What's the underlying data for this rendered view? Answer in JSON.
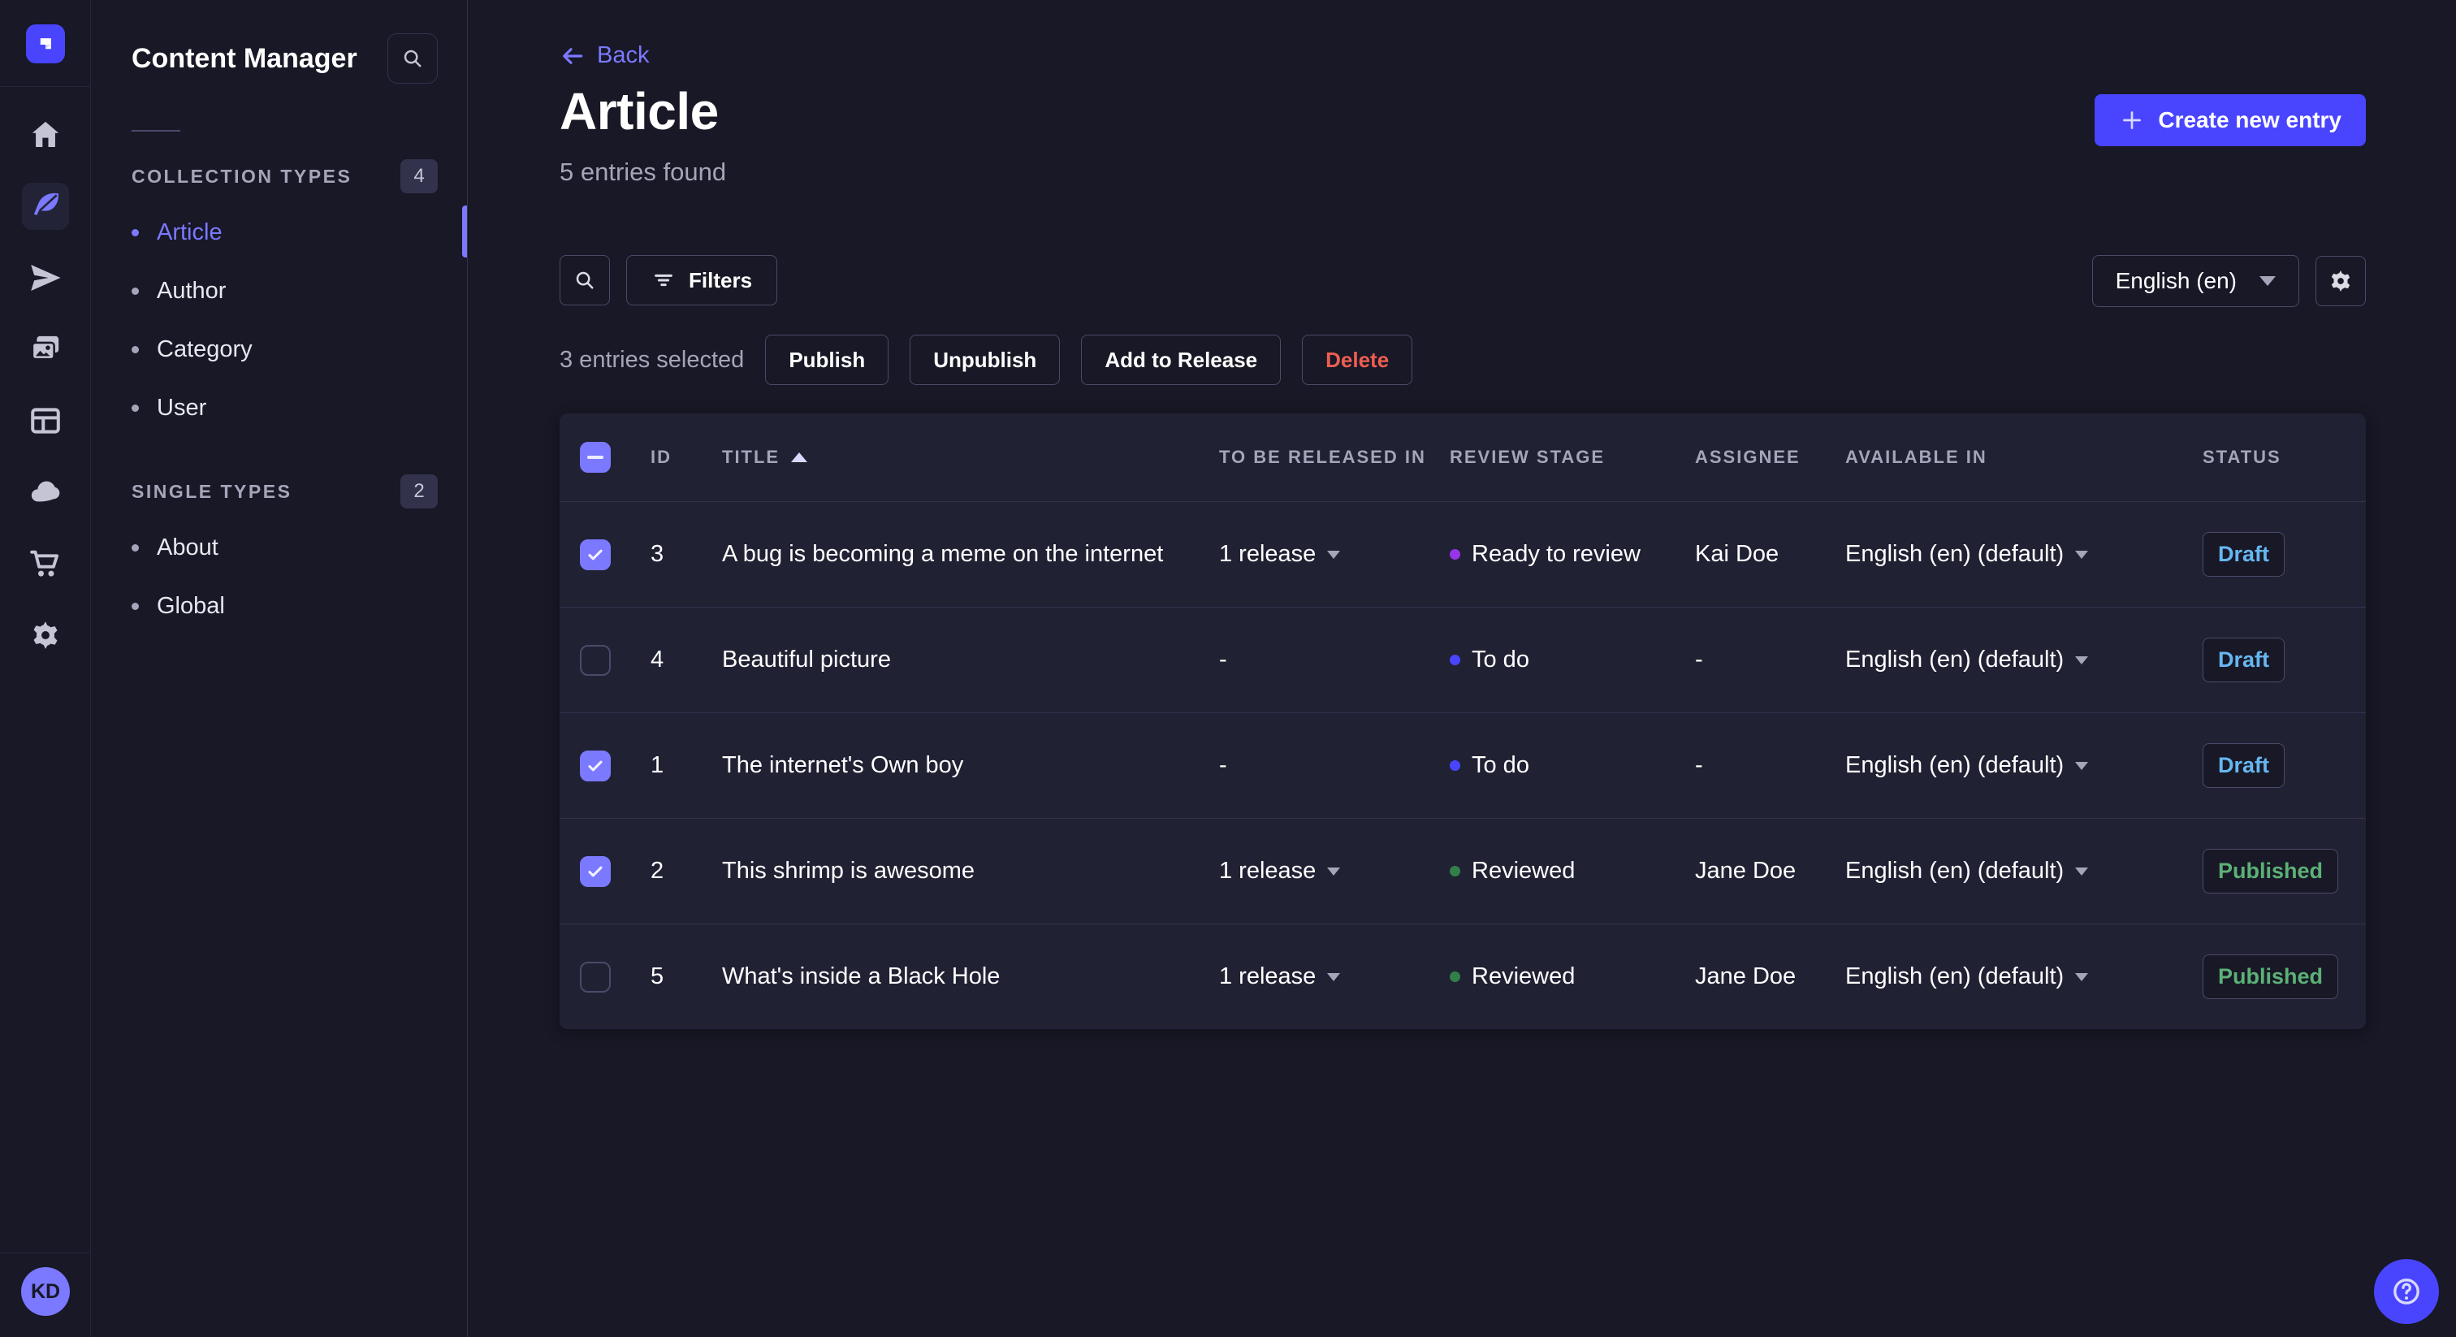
{
  "colors": {
    "primary": "#4945ff",
    "primary_light": "#7b79ff",
    "page_bg": "#181826",
    "panel_bg": "#212134",
    "border_subtle": "#32324d",
    "border_strong": "#4a4a6a",
    "text_muted": "#a5a5ba",
    "danger": "#ee5e52",
    "draft": "#66b7f1",
    "published": "#5cb176"
  },
  "rail": {
    "logo": "strapi-logo",
    "items": [
      {
        "name": "home-icon",
        "active": false
      },
      {
        "name": "content-manager-icon",
        "active": true
      },
      {
        "name": "releases-icon",
        "active": false
      },
      {
        "name": "media-library-icon",
        "active": false
      },
      {
        "name": "content-type-builder-icon",
        "active": false
      },
      {
        "name": "cloud-icon",
        "active": false
      },
      {
        "name": "marketplace-icon",
        "active": false
      },
      {
        "name": "settings-icon",
        "active": false
      }
    ],
    "user_initials": "KD"
  },
  "sidebar": {
    "title": "Content Manager",
    "sections": [
      {
        "label": "COLLECTION TYPES",
        "badge": "4",
        "items": [
          {
            "label": "Article",
            "active": true
          },
          {
            "label": "Author",
            "active": false
          },
          {
            "label": "Category",
            "active": false
          },
          {
            "label": "User",
            "active": false
          }
        ]
      },
      {
        "label": "SINGLE TYPES",
        "badge": "2",
        "items": [
          {
            "label": "About",
            "active": false
          },
          {
            "label": "Global",
            "active": false
          }
        ]
      }
    ]
  },
  "header": {
    "back_label": "Back",
    "title": "Article",
    "subtitle": "5 entries found",
    "create_label": "Create new entry"
  },
  "toolbar": {
    "filters_label": "Filters",
    "locale_value": "English (en)"
  },
  "selection": {
    "text": "3 entries selected",
    "publish_label": "Publish",
    "unpublish_label": "Unpublish",
    "add_to_release_label": "Add to Release",
    "delete_label": "Delete"
  },
  "table": {
    "columns": [
      "ID",
      "TITLE",
      "TO BE RELEASED IN",
      "REVIEW STAGE",
      "ASSIGNEE",
      "AVAILABLE IN",
      "STATUS"
    ],
    "sorted_by": "TITLE",
    "sort_direction": "asc",
    "rows": [
      {
        "checked": true,
        "id": "3",
        "title": "A bug is becoming a meme on the internet",
        "release": "1 release",
        "stage": "Ready to review",
        "stage_color": "#9736e8",
        "assignee": "Kai Doe",
        "available": "English (en) (default)",
        "status": "Draft",
        "status_color": "#66b7f1"
      },
      {
        "checked": false,
        "id": "4",
        "title": "Beautiful picture",
        "release": "-",
        "stage": "To do",
        "stage_color": "#4945ff",
        "assignee": "-",
        "available": "English (en) (default)",
        "status": "Draft",
        "status_color": "#66b7f1"
      },
      {
        "checked": true,
        "id": "1",
        "title": "The internet's Own boy",
        "release": "-",
        "stage": "To do",
        "stage_color": "#4945ff",
        "assignee": "-",
        "available": "English (en) (default)",
        "status": "Draft",
        "status_color": "#66b7f1"
      },
      {
        "checked": true,
        "id": "2",
        "title": "This shrimp is awesome",
        "release": "1 release",
        "stage": "Reviewed",
        "stage_color": "#328048",
        "assignee": "Jane Doe",
        "available": "English (en) (default)",
        "status": "Published",
        "status_color": "#5cb176"
      },
      {
        "checked": false,
        "id": "5",
        "title": "What's inside a Black Hole",
        "release": "1 release",
        "stage": "Reviewed",
        "stage_color": "#328048",
        "assignee": "Jane Doe",
        "available": "English (en) (default)",
        "status": "Published",
        "status_color": "#5cb176"
      }
    ]
  }
}
